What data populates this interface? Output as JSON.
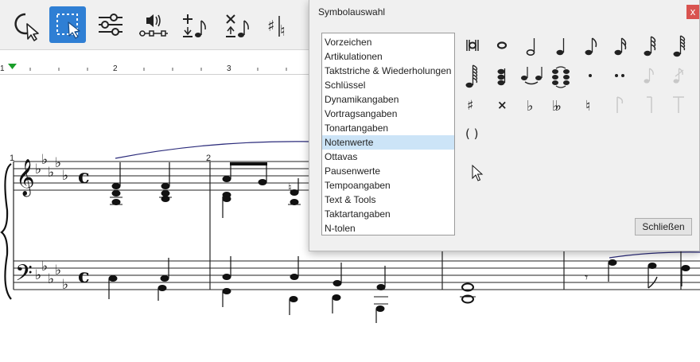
{
  "toolbar": {
    "buttons": [
      {
        "name": "pointer-tool",
        "icon": "pointer-icon",
        "active": false
      },
      {
        "name": "selection-tool",
        "icon": "selection-rect-icon",
        "active": true
      },
      {
        "name": "mixer-tool",
        "icon": "sliders-icon",
        "active": false
      },
      {
        "name": "playback-tool",
        "icon": "speaker-slider-icon",
        "active": false
      },
      {
        "name": "add-note-tool",
        "icon": "add-note-icon",
        "active": false
      },
      {
        "name": "delete-note-tool",
        "icon": "delete-note-icon",
        "active": false
      },
      {
        "name": "accidental-tool",
        "icon": "accidental-toggle-icon",
        "active": false
      }
    ],
    "accent_color": "#2f7fd4"
  },
  "ruler": {
    "labels": [
      "1",
      "2",
      "3"
    ],
    "marker": "green-triangle-icon",
    "marker_color": "#1a9e2a"
  },
  "score": {
    "measure_numbers": [
      "1",
      "2"
    ],
    "treble_key": "5 flats",
    "bass_key": "5 flats",
    "time_signature": "c",
    "time_signature_meaning": "common time"
  },
  "dialog": {
    "title": "Symbolauswahl",
    "close_glyph": "x",
    "categories": [
      "Vorzeichen",
      "Artikulationen",
      "Taktstriche & Wiederholungen",
      "Schlüssel",
      "Dynamikangaben",
      "Vortragsangaben",
      "Tonartangaben",
      "Notenwerte",
      "Ottavas",
      "Pausenwerte",
      "Tempoangaben",
      "Text & Tools",
      "Taktartangaben",
      "N-tolen"
    ],
    "selected_category": "Notenwerte",
    "symbols": [
      {
        "name": "breve-icon",
        "enabled": true
      },
      {
        "name": "whole-note-icon",
        "enabled": true
      },
      {
        "name": "half-note-icon",
        "enabled": true
      },
      {
        "name": "quarter-note-icon",
        "enabled": true
      },
      {
        "name": "eighth-note-icon",
        "enabled": true
      },
      {
        "name": "sixteenth-note-icon",
        "enabled": true
      },
      {
        "name": "thirty-second-note-icon",
        "enabled": true
      },
      {
        "name": "sixty-fourth-note-icon",
        "enabled": true
      },
      {
        "name": "hundred-twenty-eighth-note-icon",
        "enabled": true
      },
      {
        "name": "chord-icon",
        "enabled": true
      },
      {
        "name": "tie-icon",
        "enabled": true
      },
      {
        "name": "chord-tie-icon",
        "enabled": true
      },
      {
        "name": "dot-icon",
        "enabled": true
      },
      {
        "name": "double-dot-icon",
        "enabled": true
      },
      {
        "name": "grace-note-icon",
        "enabled": false
      },
      {
        "name": "grace-note-slashed-icon",
        "enabled": false
      },
      {
        "name": "sharp-icon",
        "enabled": true,
        "glyph": "♯"
      },
      {
        "name": "double-sharp-icon",
        "enabled": true,
        "glyph": "×"
      },
      {
        "name": "flat-icon",
        "enabled": true,
        "glyph": "♭"
      },
      {
        "name": "double-flat-icon",
        "enabled": true,
        "glyph": "♭♭"
      },
      {
        "name": "natural-icon",
        "enabled": true,
        "glyph": "♮"
      },
      {
        "name": "stem-flag-up-icon",
        "enabled": false
      },
      {
        "name": "stem-flag-right-icon",
        "enabled": false
      },
      {
        "name": "stem-flag-t-icon",
        "enabled": false
      },
      {
        "name": "parentheses-icon",
        "enabled": true,
        "glyph": "( )"
      }
    ],
    "close_button_label": "Schließen",
    "list_selection_color": "#cce4f7"
  }
}
